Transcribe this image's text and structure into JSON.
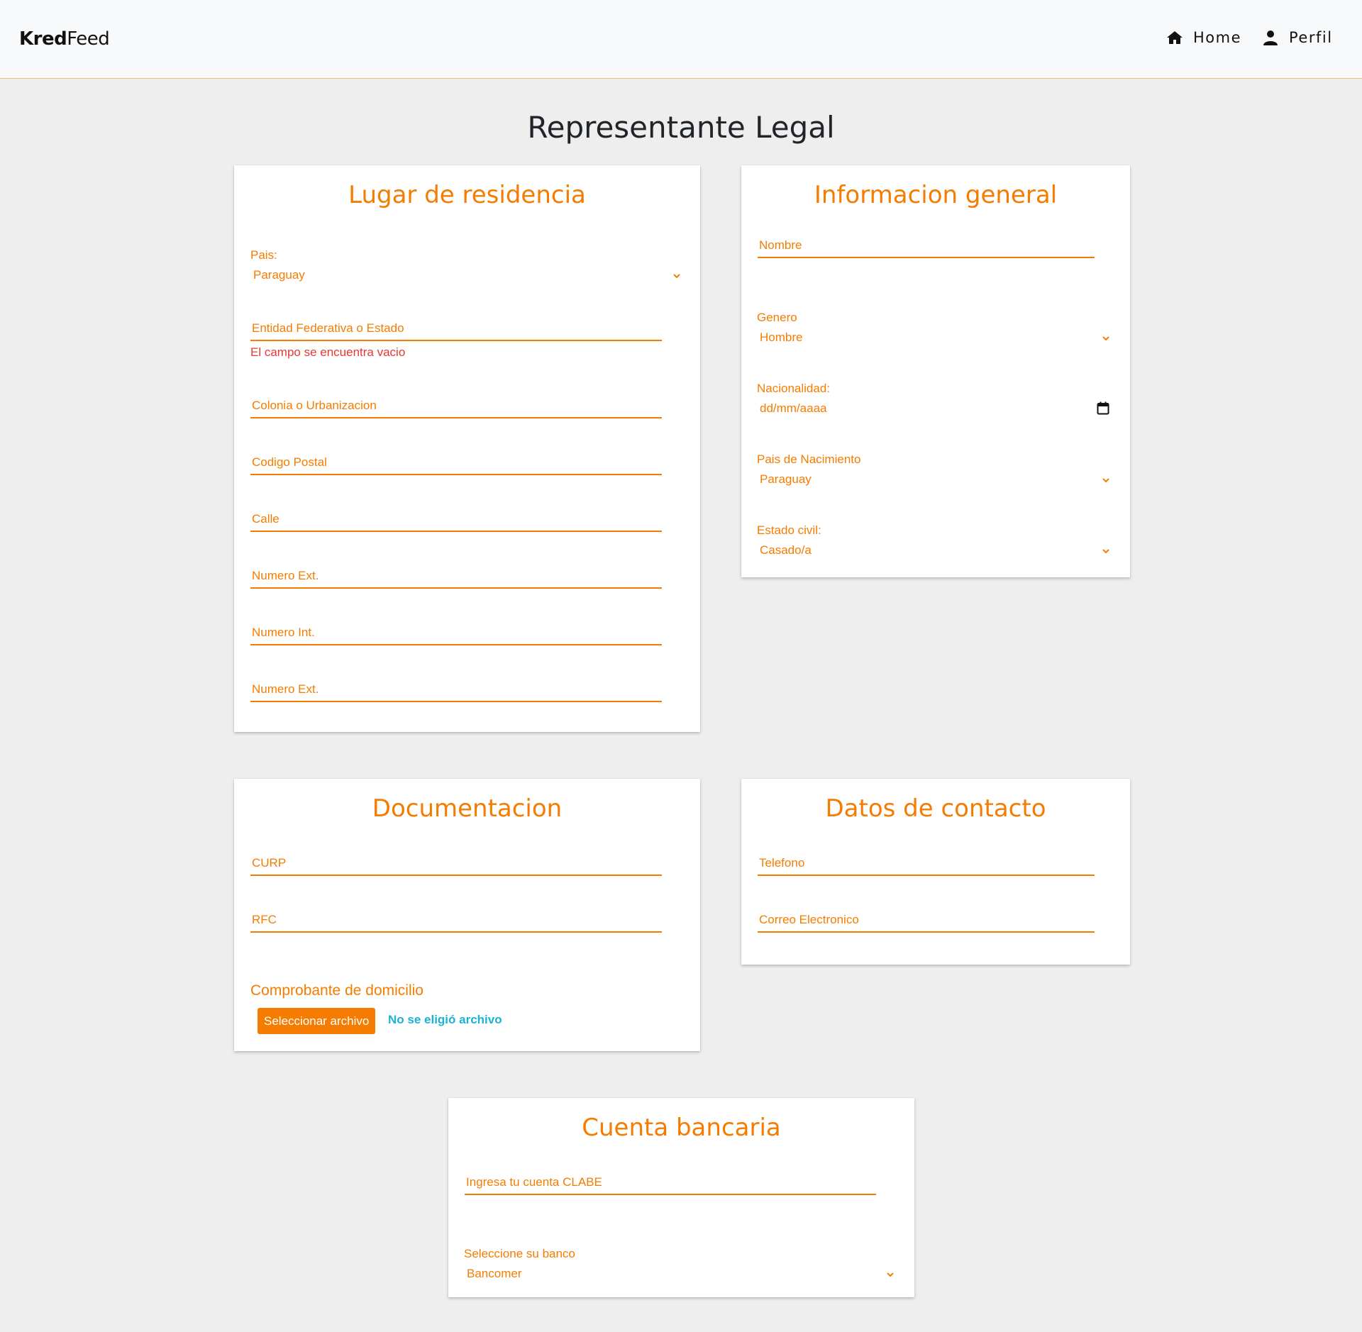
{
  "brand": {
    "bold": "Kred",
    "light": "Feed"
  },
  "nav": {
    "home": "Home",
    "profile": "Perfil"
  },
  "page_title": "Representante Legal",
  "residencia": {
    "title": "Lugar de residencia",
    "pais_label": "Pais:",
    "pais_value": "Paraguay",
    "entidad": "Entidad Federativa o Estado",
    "entidad_error": "El campo se encuentra vacio",
    "colonia": "Colonia o Urbanizacion",
    "codigo_postal": "Codigo Postal",
    "calle": "Calle",
    "numero_ext": "Numero Ext.",
    "numero_int": "Numero Int.",
    "numero_ext2": "Numero Ext."
  },
  "general": {
    "title": "Informacion general",
    "nombre": "Nombre",
    "genero_label": "Genero",
    "genero_value": "Hombre",
    "nacionalidad_label": "Nacionalidad:",
    "nacionalidad_value": "dd/mm/aaaa",
    "pais_nac_label": "Pais de Nacimiento",
    "pais_nac_value": "Paraguay",
    "estado_civil_label": "Estado civil:",
    "estado_civil_value": "Casado/a"
  },
  "documentacion": {
    "title": "Documentacion",
    "curp": "CURP",
    "rfc": "RFC",
    "comprobante": "Comprobante de domicilio",
    "file_button": "Seleccionar archivo",
    "file_status": "No se eligió archivo"
  },
  "contacto": {
    "title": "Datos de contacto",
    "telefono": "Telefono",
    "correo": "Correo Electronico"
  },
  "cuenta": {
    "title": "Cuenta bancaria",
    "clabe": "Ingresa tu cuenta CLABE",
    "banco_label": "Seleccione su banco",
    "banco_value": "Bancomer"
  },
  "colors": {
    "accent": "#f57c00",
    "error": "#e53935",
    "link": "#1ab3d6"
  }
}
